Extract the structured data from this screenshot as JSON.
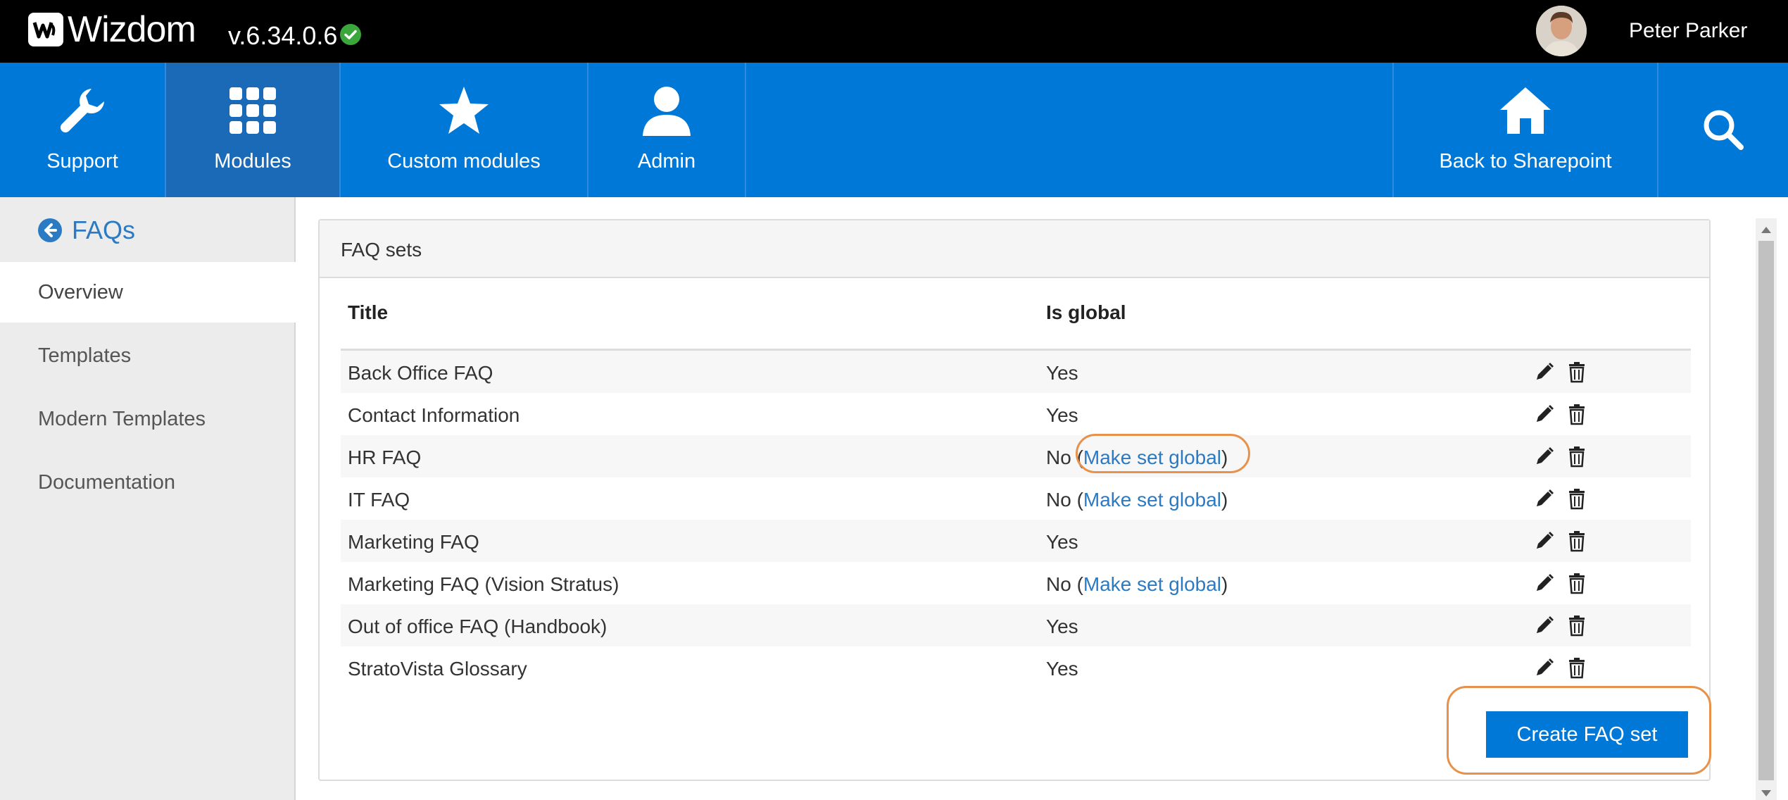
{
  "header": {
    "logo_text": "Wizdom",
    "version": "v.6.34.0.6",
    "user_name": "Peter Parker"
  },
  "nav": {
    "items": [
      {
        "label": "Support",
        "icon": "wrench-icon"
      },
      {
        "label": "Modules",
        "icon": "grid-icon"
      },
      {
        "label": "Custom modules",
        "icon": "star-icon"
      },
      {
        "label": "Admin",
        "icon": "user-icon"
      }
    ],
    "back_label": "Back to Sharepoint",
    "search_icon": "search-icon"
  },
  "sidebar": {
    "title": "FAQs",
    "items": [
      {
        "label": "Overview"
      },
      {
        "label": "Templates"
      },
      {
        "label": "Modern Templates"
      },
      {
        "label": "Documentation"
      }
    ]
  },
  "panel": {
    "title": "FAQ sets",
    "columns": {
      "title": "Title",
      "is_global": "Is global"
    },
    "rows": [
      {
        "title": "Back Office FAQ",
        "global": "Yes",
        "action": ""
      },
      {
        "title": "Contact Information",
        "global": "Yes",
        "action": ""
      },
      {
        "title": "HR FAQ",
        "global": "No",
        "action": "Make set global"
      },
      {
        "title": "IT FAQ",
        "global": "No",
        "action": "Make set global"
      },
      {
        "title": "Marketing FAQ",
        "global": "Yes",
        "action": ""
      },
      {
        "title": "Marketing FAQ (Vision Stratus)",
        "global": "No",
        "action": "Make set global"
      },
      {
        "title": "Out of office FAQ (Handbook)",
        "global": "Yes",
        "action": ""
      },
      {
        "title": "StratoVista Glossary",
        "global": "Yes",
        "action": ""
      }
    ],
    "create_label": "Create FAQ set"
  },
  "colors": {
    "nav_blue": "#0078d7",
    "active_nav": "#1a6ab8",
    "link_blue": "#2a7ac4",
    "highlight_orange": "#e8914a",
    "status_green": "#3ba63b"
  }
}
